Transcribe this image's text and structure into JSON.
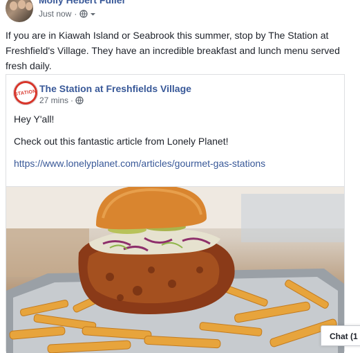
{
  "post": {
    "author": "Molly Hebert Fuller",
    "time": "Just now",
    "separator": "·",
    "text": "If you are in Kiawah Island or Seabrook this summer, stop by The Station at Freshfield's Village. They have an incredible breakfast and lunch menu served fresh daily."
  },
  "shared": {
    "logo_text": "STATION",
    "page_name": "The Station at Freshfields Village",
    "time": "27 mins",
    "separator": "·",
    "greeting": "Hey Y'all!",
    "body": "Check out this fantastic article from Lonely Planet!",
    "link": "https://www.lonelyplanet.com/articles/gourmet-gas-stations"
  },
  "icons": {
    "privacy": "globe-icon",
    "audience_dropdown": "chevron-down-icon",
    "more": "more-options-icon"
  },
  "chat": {
    "label": "Chat (1"
  },
  "colors": {
    "link": "#385898",
    "text": "#1d2129",
    "meta": "#606770",
    "border": "#dddfe2",
    "logo_red": "#d8352a"
  }
}
